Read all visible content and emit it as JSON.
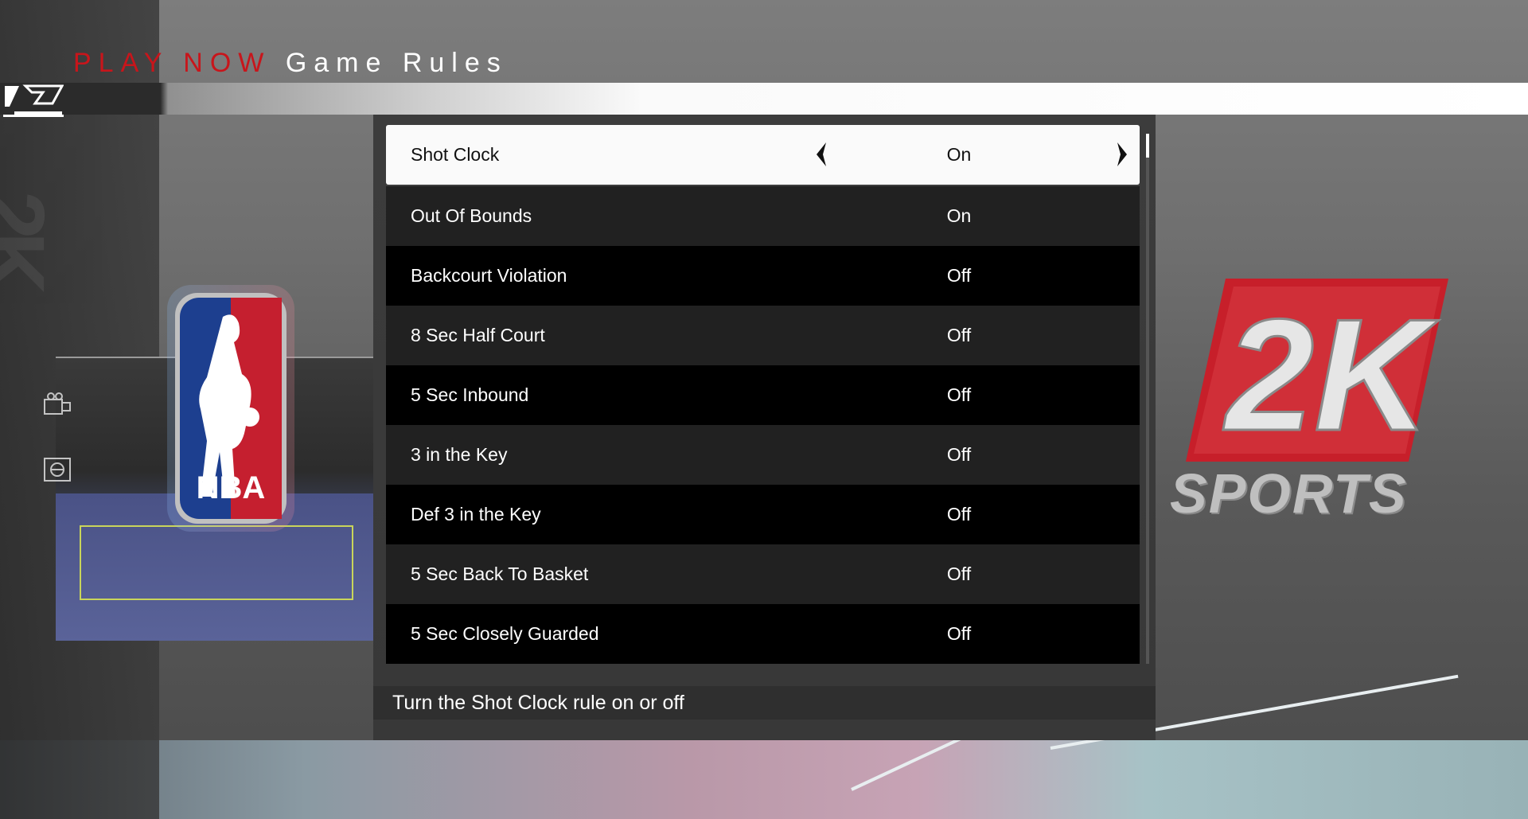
{
  "header": {
    "title_part1": "PLAY",
    "title_part2": "NOW",
    "title_part3": "Game Rules"
  },
  "colors": {
    "accent_red": "#c8151b",
    "selected_row_bg": "#fafafa",
    "row_dark": "#000000",
    "row_gray": "#212121"
  },
  "logos": {
    "league": "NBA",
    "publisher": "2K",
    "publisher_sub": "SPORTS"
  },
  "side_icons": [
    "camera-icon",
    "court-ball-icon"
  ],
  "rules": [
    {
      "label": "Shot Clock",
      "value": "On",
      "selected": true
    },
    {
      "label": "Out Of Bounds",
      "value": "On"
    },
    {
      "label": "Backcourt Violation",
      "value": "Off"
    },
    {
      "label": "8 Sec Half Court",
      "value": "Off"
    },
    {
      "label": "5 Sec Inbound",
      "value": "Off"
    },
    {
      "label": "3 in the Key",
      "value": "Off"
    },
    {
      "label": "Def 3 in the Key",
      "value": "Off"
    },
    {
      "label": "5 Sec Back To Basket",
      "value": "Off"
    },
    {
      "label": "5 Sec Closely Guarded",
      "value": "Off"
    }
  ],
  "description": "Turn the Shot Clock rule on or off"
}
